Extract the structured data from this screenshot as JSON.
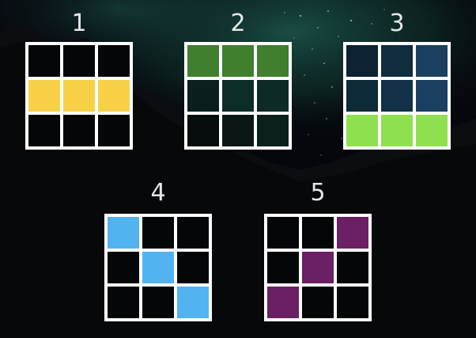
{
  "patterns": [
    {
      "label": "1",
      "cells": [
        "#050608",
        "#050608",
        "#050608",
        "#f7d048",
        "#f7d048",
        "#f7d048",
        "#050608",
        "#050608",
        "#050608"
      ]
    },
    {
      "label": "2",
      "cells": [
        "#3f7f2e",
        "#3f7f2e",
        "#3f7f2e",
        "#0a1f1d",
        "#0c2c28",
        "#0d2a27",
        "#070d0c",
        "#0a1715",
        "#0b1f1d"
      ]
    },
    {
      "label": "3",
      "cells": [
        "#0d2233",
        "#112b3f",
        "#1a3f60",
        "#0d2a38",
        "#123046",
        "#1b3e63",
        "#8fe04f",
        "#8fe04f",
        "#8fe04f"
      ]
    },
    {
      "label": "4",
      "cells": [
        "#53b2f0",
        "#050608",
        "#050608",
        "#050608",
        "#53b2f0",
        "#050608",
        "#050608",
        "#050608",
        "#53b2f0"
      ]
    },
    {
      "label": "5",
      "cells": [
        "#050608",
        "#050608",
        "#6b1f64",
        "#050608",
        "#6b1f64",
        "#050608",
        "#6b1f64",
        "#050608",
        "#050608"
      ]
    }
  ],
  "colors": {
    "grid_border": "#ffffff",
    "label_text": "#e6e6e6",
    "sky": "#06070d"
  }
}
